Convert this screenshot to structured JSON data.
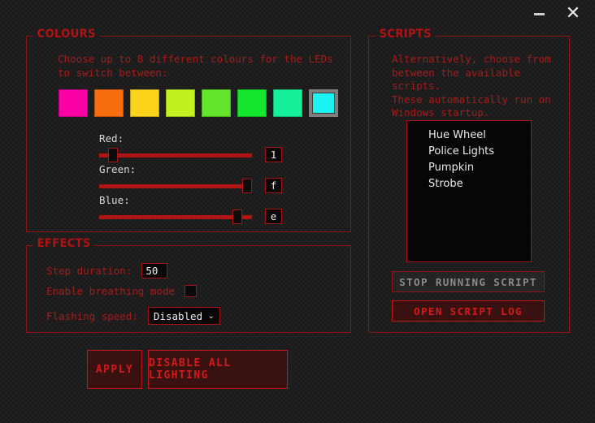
{
  "window": {
    "minimize_label": "–",
    "close_label": "✕"
  },
  "colours": {
    "group_label": "COLOURS",
    "description": "Choose up to 8 different colours for the LEDs\nto switch between:",
    "swatches": [
      {
        "name": "swatch-magenta",
        "hex": "#FB00A5",
        "selected": false
      },
      {
        "name": "swatch-orange",
        "hex": "#F96D11",
        "selected": false
      },
      {
        "name": "swatch-yellow",
        "hex": "#FBD31B",
        "selected": false
      },
      {
        "name": "swatch-lime",
        "hex": "#C2F020",
        "selected": false
      },
      {
        "name": "swatch-green",
        "hex": "#63E52B",
        "selected": false
      },
      {
        "name": "swatch-green2",
        "hex": "#14E72D",
        "selected": false
      },
      {
        "name": "swatch-spring",
        "hex": "#16F09A",
        "selected": false
      },
      {
        "name": "swatch-cyan",
        "hex": "#1BF3F3",
        "selected": true
      }
    ],
    "sliders": [
      {
        "name": "red",
        "label": "Red:",
        "value": "1",
        "percent": 6
      },
      {
        "name": "green",
        "label": "Green:",
        "value": "f",
        "percent": 100
      },
      {
        "name": "blue",
        "label": "Blue:",
        "value": "e",
        "percent": 93
      }
    ]
  },
  "effects": {
    "group_label": "EFFECTS",
    "step_duration_label": "Step duration:",
    "step_duration_value": "50",
    "breathing_label": "Enable breathing mode",
    "breathing_checked": false,
    "flashing_label": "Flashing speed:",
    "flashing_value": "Disabled",
    "flashing_caret": "⌄"
  },
  "scripts": {
    "group_label": "SCRIPTS",
    "description": "Alternatively, choose from\nbetween the available\nscripts.\nThese automatically run on\nWindows startup.",
    "items": [
      {
        "label": "Hue Wheel"
      },
      {
        "label": "Police Lights"
      },
      {
        "label": "Pumpkin"
      },
      {
        "label": "Strobe"
      }
    ],
    "stop_button": "STOP RUNNING SCRIPT",
    "log_button": "OPEN SCRIPT LOG"
  },
  "actions": {
    "apply_label": "APPLY",
    "disable_all_label": "DISABLE ALL LIGHTING"
  },
  "theme": {
    "accent": "#b91c1c",
    "border": "#8e1414",
    "background": "#1b1b1b"
  }
}
